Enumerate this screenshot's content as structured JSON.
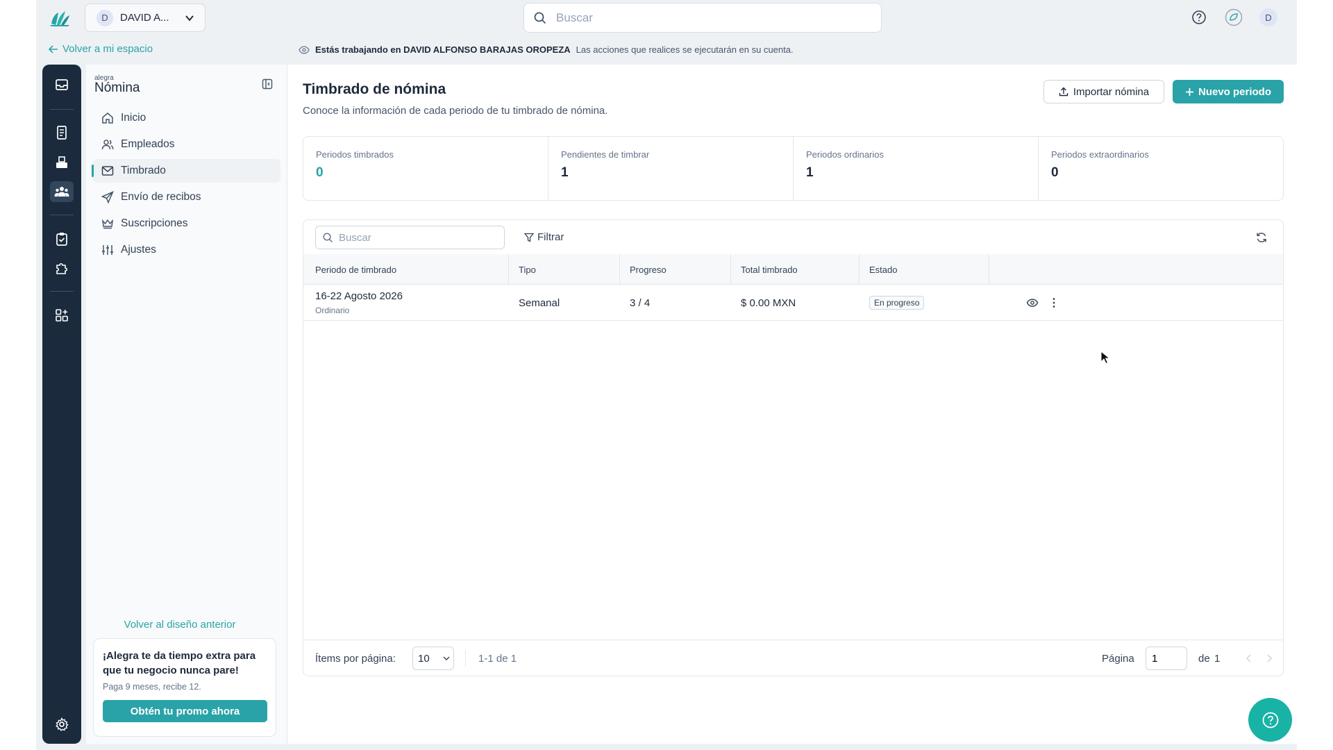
{
  "topbar": {
    "company_initial": "D",
    "company_name": "DAVID A...",
    "search_placeholder": "Buscar",
    "user_initial": "D"
  },
  "back_link": "Volver a mi espacio",
  "notice": {
    "prefix": "Estás trabajando en DAVID ALFONSO BARAJAS OROPEZA",
    "suffix": "Las acciones que realices se ejecutarán en su cuenta."
  },
  "sidebar": {
    "brand_small": "alegra",
    "brand_big": "Nómina",
    "items": [
      {
        "label": "Inicio",
        "icon": "home-icon"
      },
      {
        "label": "Empleados",
        "icon": "users-icon"
      },
      {
        "label": "Timbrado",
        "icon": "mail-icon",
        "active": true
      },
      {
        "label": "Envío de recibos",
        "icon": "send-icon"
      },
      {
        "label": "Suscripciones",
        "icon": "crown-icon"
      },
      {
        "label": "Ajustes",
        "icon": "sliders-icon"
      }
    ],
    "revert_link": "Volver al diseño anterior",
    "promo": {
      "title": "¡Alegra te da tiempo extra para que tu negocio nunca pare!",
      "subtitle": "Paga 9 meses, recibe 12.",
      "button": "Obtén tu promo ahora"
    }
  },
  "main": {
    "title": "Timbrado de nómina",
    "subtitle": "Conoce la información de cada periodo de tu timbrado de nómina.",
    "import_button": "Importar nómina",
    "new_button": "Nuevo periodo",
    "stats": [
      {
        "label": "Periodos timbrados",
        "value": "0"
      },
      {
        "label": "Pendientes de timbrar",
        "value": "1"
      },
      {
        "label": "Periodos ordinarios",
        "value": "1"
      },
      {
        "label": "Periodos extraordinarios",
        "value": "0"
      }
    ],
    "table": {
      "search_placeholder": "Buscar",
      "filter_label": "Filtrar",
      "columns": [
        "Periodo de timbrado",
        "Tipo",
        "Progreso",
        "Total timbrado",
        "Estado"
      ],
      "rows": [
        {
          "period": "16-22 Agosto 2026",
          "period_sub": "Ordinario",
          "type": "Semanal",
          "progress": "3 / 4",
          "total": "$ 0.00 MXN",
          "status": "En progreso"
        }
      ],
      "footer": {
        "per_page_label": "Ítems por página:",
        "per_page_value": "10",
        "range": "1-1 de 1",
        "page_label": "Página",
        "page_value": "1",
        "of_label": "de",
        "total_pages": "1"
      }
    }
  },
  "colors": {
    "accent": "#29a3a8",
    "rail": "#1b2b3d",
    "fab": "#18b3a5"
  }
}
